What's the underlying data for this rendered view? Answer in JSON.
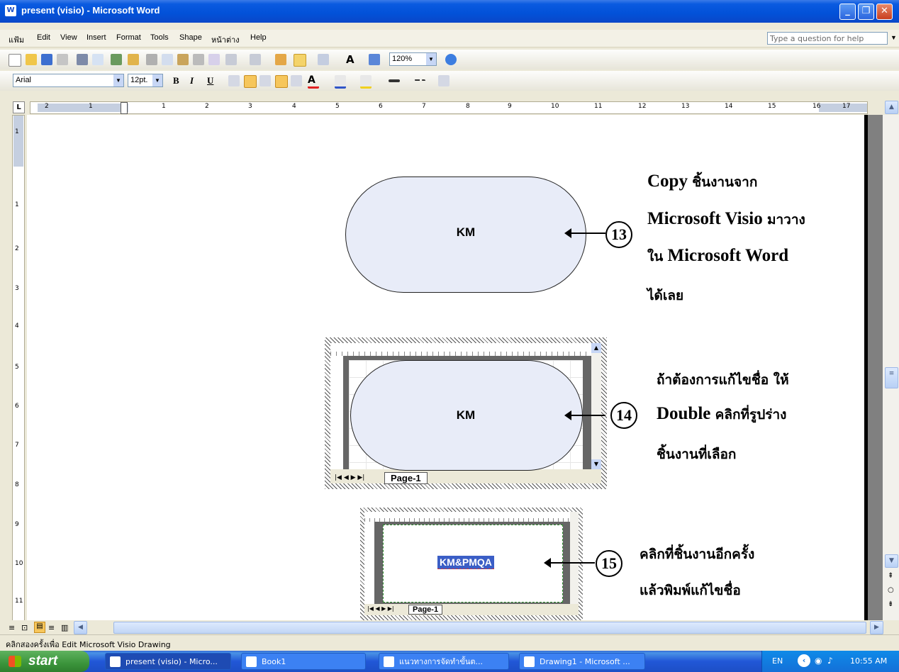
{
  "window": {
    "title": "present (visio) - Microsoft Word"
  },
  "menu": {
    "items": [
      "แฟ้ม",
      "Edit",
      "View",
      "Insert",
      "Format",
      "Tools",
      "Shape",
      "หน้าต่าง",
      "Help"
    ],
    "help_placeholder": "Type a question for help"
  },
  "toolbar": {
    "zoom": "120%",
    "font": "Arial",
    "size": "12pt."
  },
  "ruler": {
    "h_labels": [
      "2",
      "1",
      "1",
      "2",
      "3",
      "4",
      "5",
      "6",
      "7",
      "8",
      "9",
      "10",
      "11",
      "12",
      "13",
      "14",
      "15",
      "16",
      "17",
      "18"
    ],
    "v_labels": [
      "1",
      "1",
      "2",
      "3",
      "4",
      "5",
      "6",
      "7",
      "8",
      "9",
      "10",
      "11"
    ]
  },
  "doc": {
    "shape1_label": "KM",
    "shape2_label": "KM",
    "shape3_label": "KM&PMQA",
    "page_tab": "Page-1",
    "page_tab2": "Page-1",
    "step13": "13",
    "step14": "14",
    "step15": "15",
    "note13": {
      "l1a": "Copy",
      "l1b": "ชิ้นงานจาก",
      "l2a": "Microsoft  Visio",
      "l2b": "มาวาง",
      "l3a": "ใน",
      "l3b": "Microsoft  Word",
      "l4": "ได้เลย"
    },
    "note14": {
      "l1": "ถ้าต้องการแก้ไขชื่อ  ให้",
      "l2a": "Double",
      "l2b": "คลิกที่รูปร่าง",
      "l3": "ชิ้นงานที่เลือก"
    },
    "note15": {
      "l1": "คลิกที่ชิ้นงานอีกครั้ง",
      "l2": "แล้วพิมพ์แก้ไขชื่อ"
    }
  },
  "status": {
    "text": "คลิกสองครั้งเพื่อ Edit Microsoft Visio Drawing"
  },
  "taskbar": {
    "start": "start",
    "tasks": [
      "present (visio) - Micro...",
      "Book1",
      "แนวทางการจัดทำขั้นต...",
      "Drawing1 - Microsoft ..."
    ],
    "lang": "EN",
    "clock": "10:55 AM"
  },
  "colors": {
    "titlebar": "#0a5ae0",
    "shape_fill": "#e8ecf8",
    "selection": "#3b5ec6",
    "taskbar": "#2157d7",
    "start": "#3b943b"
  }
}
